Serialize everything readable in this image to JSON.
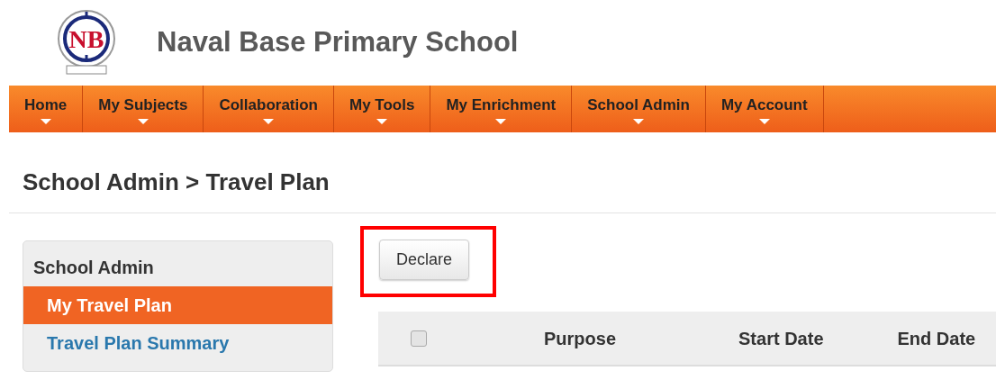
{
  "header": {
    "logo_text": "NB",
    "title": "Naval Base Primary School"
  },
  "nav": [
    {
      "label": "Home"
    },
    {
      "label": "My Subjects"
    },
    {
      "label": "Collaboration"
    },
    {
      "label": "My Tools"
    },
    {
      "label": "My Enrichment"
    },
    {
      "label": "School Admin"
    },
    {
      "label": "My Account"
    }
  ],
  "breadcrumb": "School Admin > Travel Plan",
  "sidebar": {
    "title": "School Admin",
    "items": [
      {
        "label": "My Travel Plan",
        "selected": true
      },
      {
        "label": "Travel Plan Summary",
        "selected": false
      }
    ]
  },
  "declare_button": "Declare",
  "table": {
    "select_all_checked": false,
    "columns": [
      "Purpose",
      "Start Date",
      "End Date"
    ]
  }
}
